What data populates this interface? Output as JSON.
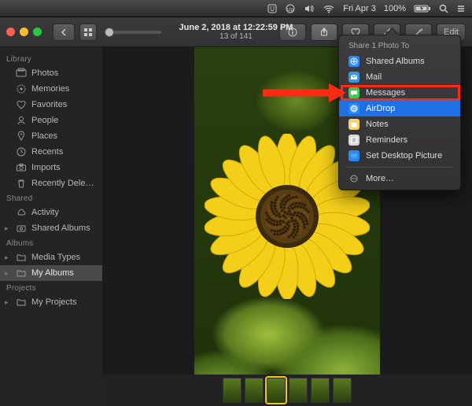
{
  "menubar": {
    "clock": "Fri Apr 3",
    "battery": "100%"
  },
  "toolbar": {
    "title": "June 2, 2018 at 12:22:59 PM",
    "subtitle": "13 of 141",
    "edit_label": "Edit"
  },
  "sidebar": {
    "sections": [
      {
        "header": "Library",
        "items": [
          {
            "label": "Photos",
            "icon": "photos"
          },
          {
            "label": "Memories",
            "icon": "memories"
          },
          {
            "label": "Favorites",
            "icon": "heart"
          },
          {
            "label": "People",
            "icon": "people"
          },
          {
            "label": "Places",
            "icon": "pin"
          },
          {
            "label": "Recents",
            "icon": "clock"
          },
          {
            "label": "Imports",
            "icon": "camera"
          },
          {
            "label": "Recently Dele…",
            "icon": "trash"
          }
        ]
      },
      {
        "header": "Shared",
        "items": [
          {
            "label": "Activity",
            "icon": "cloud"
          },
          {
            "label": "Shared Albums",
            "icon": "shared",
            "expandable": true
          }
        ]
      },
      {
        "header": "Albums",
        "items": [
          {
            "label": "Media Types",
            "icon": "folder",
            "expandable": true
          },
          {
            "label": "My Albums",
            "icon": "folder",
            "expandable": true,
            "selected": true
          }
        ]
      },
      {
        "header": "Projects",
        "items": [
          {
            "label": "My Projects",
            "icon": "folder",
            "expandable": true
          }
        ]
      }
    ]
  },
  "share_popover": {
    "header": "Share 1 Photo To",
    "items": [
      {
        "label": "Shared Albums",
        "icon": "shared",
        "color": "#2a88ff"
      },
      {
        "label": "Mail",
        "icon": "mail",
        "color": "#3a97e8"
      },
      {
        "label": "Messages",
        "icon": "messages",
        "color": "#44c856"
      },
      {
        "label": "AirDrop",
        "icon": "airdrop",
        "color": "#2a88ff",
        "selected": true
      },
      {
        "label": "Notes",
        "icon": "notes",
        "color": "#f5d46a"
      },
      {
        "label": "Reminders",
        "icon": "reminders",
        "color": "#d8d8d8"
      },
      {
        "label": "Set Desktop Picture",
        "icon": "desktop",
        "color": "#2a88ff"
      }
    ],
    "more_label": "More…"
  }
}
